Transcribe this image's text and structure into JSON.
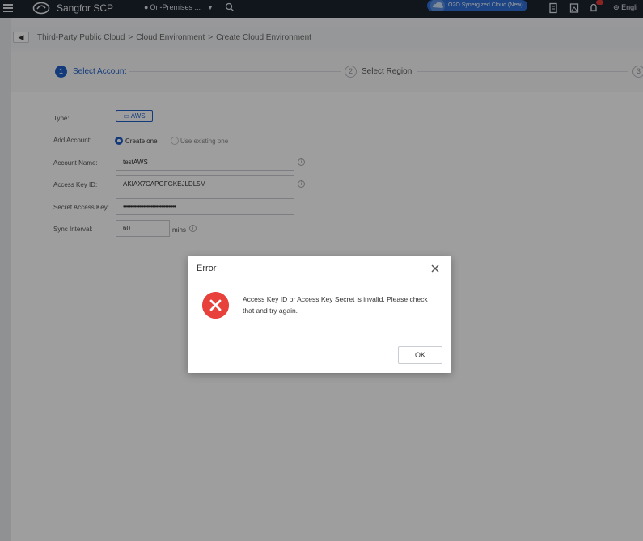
{
  "topbar": {
    "brand": "Sangfor SCP",
    "location": "On-Premises ...",
    "cloud_badge": "O2O Synergized Cloud (New)",
    "language": "Engli"
  },
  "breadcrumb": {
    "items": [
      "Third-Party Public Cloud",
      "Cloud Environment",
      "Create Cloud Environment"
    ],
    "separator": ">"
  },
  "steps": [
    {
      "number": "1",
      "label": "Select Account"
    },
    {
      "number": "2",
      "label": "Select Region"
    },
    {
      "number": "3",
      "label": ""
    }
  ],
  "form": {
    "type_label": "Type:",
    "type_value": "AWS",
    "add_account_label": "Add Account:",
    "option_create": "Create one",
    "option_existing": "Use existing one",
    "account_name_label": "Account Name:",
    "account_name_value": "testAWS",
    "access_key_label": "Access Key ID:",
    "access_key_value": "AKIAX7CAPGFGKEJLDL5M",
    "secret_key_label": "Secret Access Key:",
    "secret_key_value": "••••••••••••••••••••••••••••••••••••",
    "sync_label": "Sync Interval:",
    "sync_value": "60",
    "sync_unit": "mins"
  },
  "dialog": {
    "title": "Error",
    "message": "Access Key ID or Access Key Secret is invalid. Please check that and try again.",
    "ok_label": "OK"
  },
  "colors": {
    "accent": "#1f5fc8",
    "error": "#e8403b",
    "topbar": "#1c2430"
  }
}
